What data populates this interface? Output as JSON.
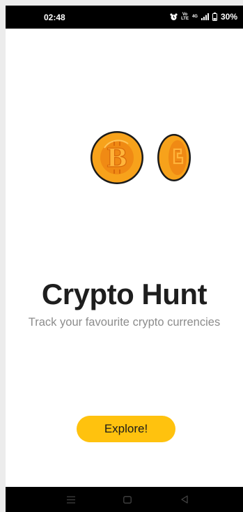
{
  "status_bar": {
    "time": "02:48",
    "battery": "30%",
    "icons": [
      "alarm-icon",
      "volte-icon",
      "network-4g-icon",
      "signal-icon",
      "battery-icon"
    ]
  },
  "logo": {
    "icon_names": [
      "bitcoin-coin-icon",
      "coin-edge-icon"
    ],
    "colors": {
      "coin": "#f7a21b",
      "inner": "#f08a14",
      "outline": "#1a1a1a"
    }
  },
  "app": {
    "title": "Crypto Hunt",
    "subtitle": "Track your favourite crypto currencies"
  },
  "explore_button": {
    "label": "Explore!",
    "color": "#ffc20e"
  },
  "nav_bar": {
    "icons": [
      "menu-icon",
      "home-icon",
      "back-icon"
    ]
  }
}
